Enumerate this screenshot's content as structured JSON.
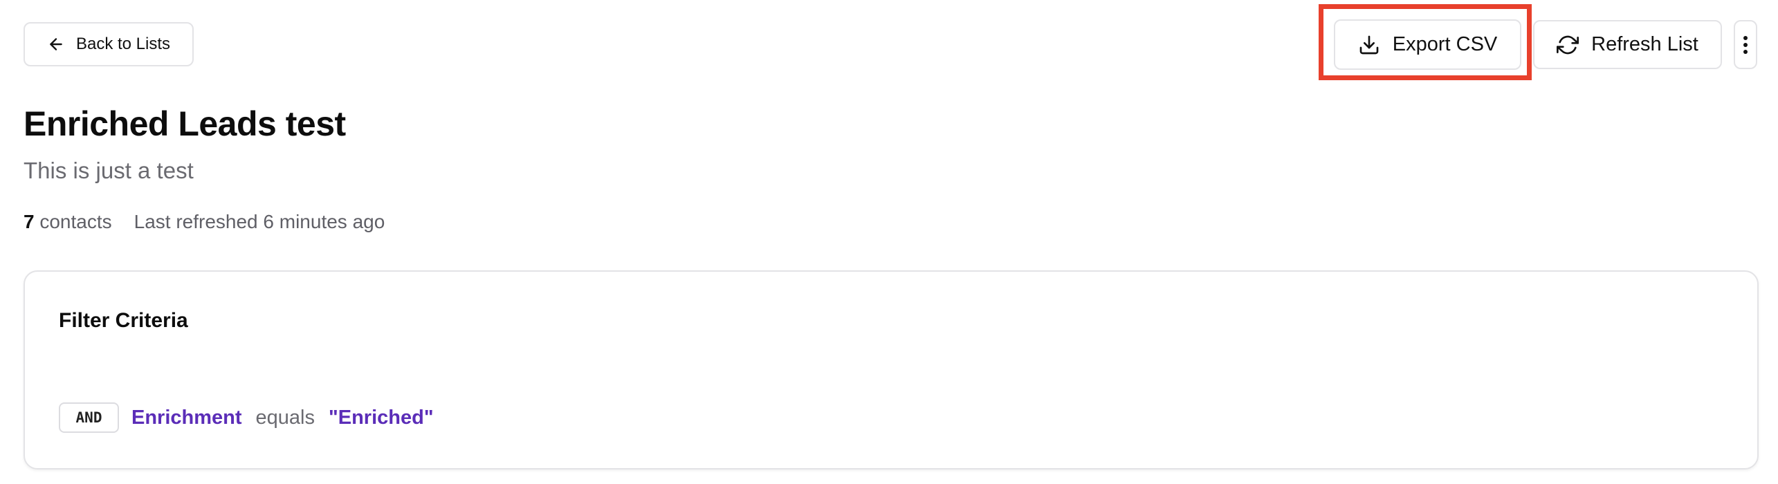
{
  "header": {
    "back_label": "Back to Lists",
    "export_label": "Export CSV",
    "refresh_label": "Refresh List"
  },
  "list": {
    "title": "Enriched Leads test",
    "description": "This is just a test",
    "contact_count": "7",
    "contacts_word": "contacts",
    "last_refreshed": "Last refreshed 6 minutes ago"
  },
  "filter": {
    "heading": "Filter Criteria",
    "operator": "AND",
    "field": "Enrichment",
    "comparison": "equals",
    "value": "\"Enriched\""
  },
  "icons": {
    "back": "arrow-left-icon",
    "export": "download-icon",
    "refresh": "refresh-icon",
    "more": "more-vertical-icon"
  },
  "colors": {
    "highlight": "#e8402c",
    "accent": "#5b2db8"
  }
}
